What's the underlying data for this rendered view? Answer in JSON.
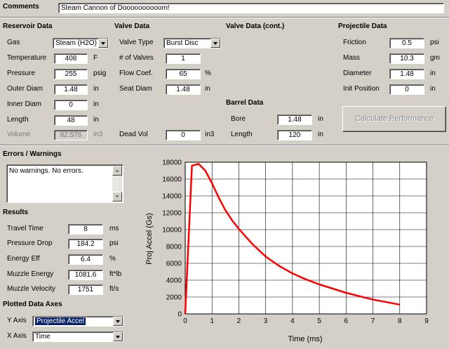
{
  "comments": {
    "label": "Comments",
    "value": "Steam Cannon of Doooooooooom!"
  },
  "reservoir": {
    "title": "Reservoir Data",
    "gas": {
      "label": "Gas",
      "value": "Steam (H2O)"
    },
    "temperature": {
      "label": "Temperature",
      "value": "408",
      "unit": "F"
    },
    "pressure": {
      "label": "Pressure",
      "value": "255",
      "unit": "psig"
    },
    "outer_diam": {
      "label": "Outer Diam",
      "value": "1.48",
      "unit": "in"
    },
    "inner_diam": {
      "label": "Inner Diam",
      "value": "0",
      "unit": "in"
    },
    "length": {
      "label": "Length",
      "value": "48",
      "unit": "in"
    },
    "volume": {
      "label": "Volume",
      "value": "82.576",
      "unit": "in3"
    }
  },
  "valve": {
    "title": "Valve Data",
    "type": {
      "label": "Valve Type",
      "value": "Burst Disc"
    },
    "num_valves": {
      "label": "# of Valves",
      "value": "1"
    },
    "flow_coef": {
      "label": "Flow Coef.",
      "value": "65",
      "unit": "%"
    },
    "seat_diam": {
      "label": "Seat Diam",
      "value": "1.48",
      "unit": "in"
    },
    "dead_vol": {
      "label": "Dead Vol",
      "value": "0",
      "unit": "in3"
    }
  },
  "valve_cont": {
    "title": "Valve Data (cont.)"
  },
  "barrel": {
    "title": "Barrel Data",
    "bore": {
      "label": "Bore",
      "value": "1.48",
      "unit": "in"
    },
    "length": {
      "label": "Length",
      "value": "120",
      "unit": "in"
    }
  },
  "projectile": {
    "title": "Projectile Data",
    "friction": {
      "label": "Friction",
      "value": "0.5",
      "unit": "psi"
    },
    "mass": {
      "label": "Mass",
      "value": "10.3",
      "unit": "gm"
    },
    "diameter": {
      "label": "Diameter",
      "value": "1.48",
      "unit": "in"
    },
    "init_position": {
      "label": "Init Position",
      "value": "0",
      "unit": "in"
    }
  },
  "calculate_button": "Calculate Performance",
  "errors": {
    "title": "Errors / Warnings",
    "text": "No warnings.  No errors."
  },
  "results": {
    "title": "Results",
    "travel_time": {
      "label": "Travel Time",
      "value": "8",
      "unit": "ms"
    },
    "pressure_drop": {
      "label": "Pressure Drop",
      "value": "184.2",
      "unit": "psi"
    },
    "energy_eff": {
      "label": "Energy Eff",
      "value": "6.4",
      "unit": "%"
    },
    "muzzle_energy": {
      "label": "Muzzle Energy",
      "value": "1081.6",
      "unit": "ft*lb"
    },
    "muzzle_velocity": {
      "label": "Muzzle Velocity",
      "value": "1751",
      "unit": "ft/s"
    }
  },
  "plot_axes": {
    "title": "Plotted Data Axes",
    "y_axis": {
      "label": "Y Axis",
      "value": "Projectile Accel"
    },
    "x_axis": {
      "label": "X Axis",
      "value": "Time"
    }
  },
  "colors": {
    "curve": "#ff0000",
    "selected_bg": "#0a246a"
  },
  "chart_data": {
    "type": "line",
    "xlabel": "Time (ms)",
    "ylabel": "Proj Accel (Gs)",
    "xlim": [
      0,
      9
    ],
    "ylim": [
      0,
      18000
    ],
    "xticks": [
      "0",
      "1",
      "2",
      "3",
      "4",
      "5",
      "6",
      "7",
      "8",
      "9"
    ],
    "yticks": [
      "0",
      "2000",
      "4000",
      "6000",
      "8000",
      "10000",
      "12000",
      "14000",
      "16000",
      "18000"
    ],
    "grid": true,
    "series": [
      {
        "x": [
          0,
          0.1,
          0.25,
          0.5,
          0.75,
          1.0,
          1.25,
          1.5,
          1.75,
          2.0,
          2.5,
          3.0,
          3.5,
          4.0,
          4.5,
          5.0,
          5.5,
          6.0,
          6.5,
          7.0,
          7.5,
          8.0
        ],
        "y": [
          0,
          7000,
          17600,
          17800,
          17000,
          15500,
          13800,
          12300,
          11100,
          10100,
          8300,
          6800,
          5700,
          4800,
          4100,
          3500,
          3000,
          2500,
          2100,
          1700,
          1400,
          1100
        ]
      }
    ]
  }
}
